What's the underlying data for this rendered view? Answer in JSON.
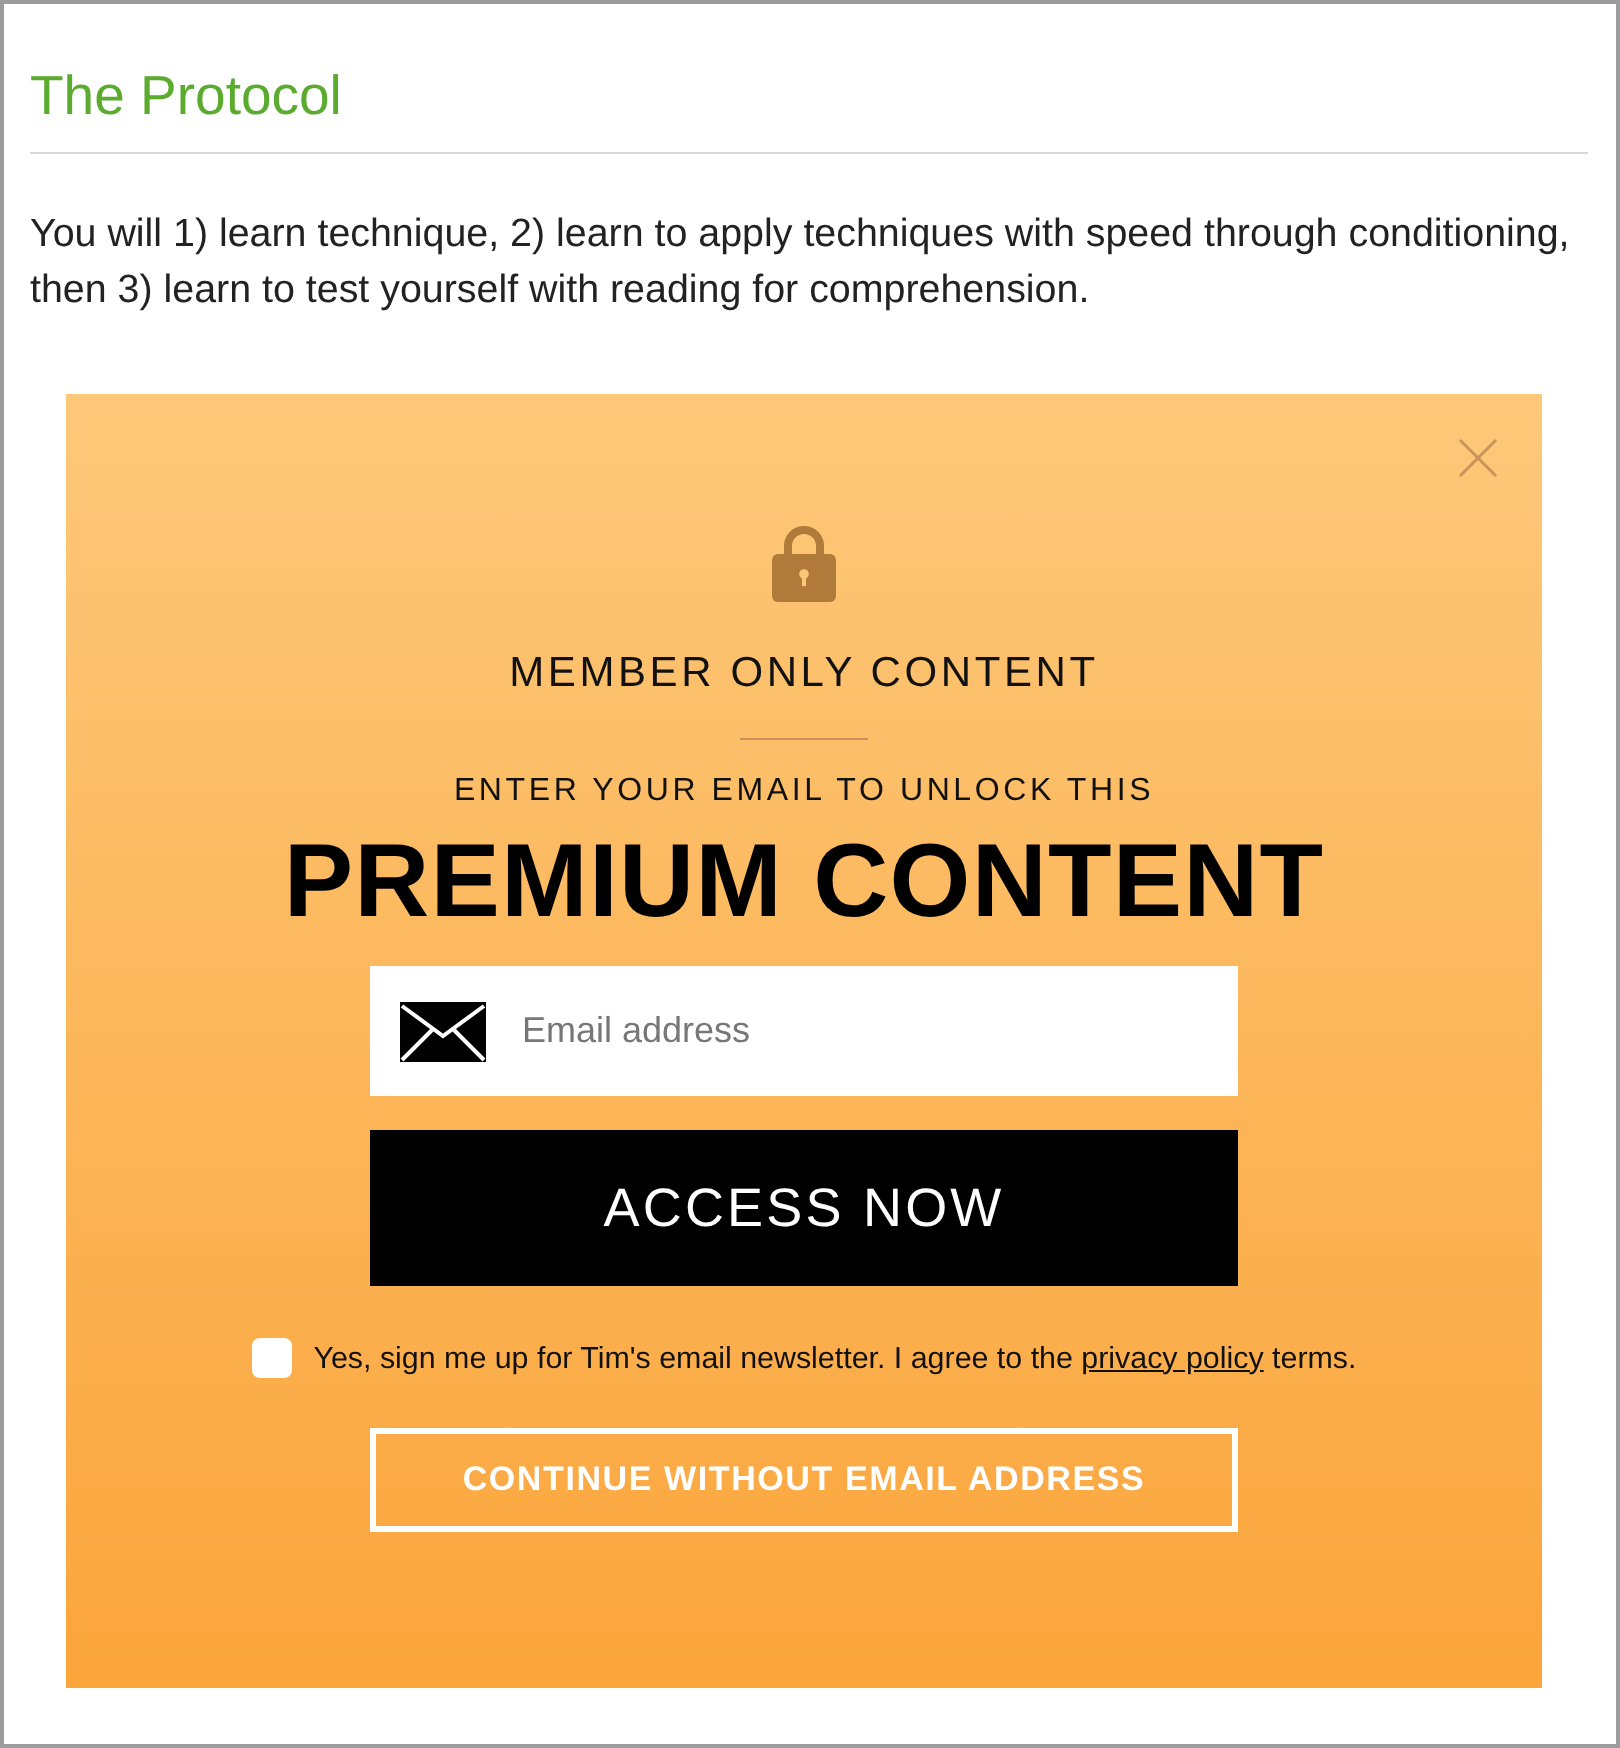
{
  "article": {
    "heading": "The Protocol",
    "paragraph": "You will 1) learn technique, 2) learn to apply techniques with speed through conditioning, then 3) learn to test yourself with reading for comprehension."
  },
  "popup": {
    "title": "MEMBER ONLY CONTENT",
    "subtitle": "ENTER YOUR EMAIL TO UNLOCK THIS",
    "headline": "PREMIUM CONTENT",
    "email_field": {
      "placeholder": "Email address"
    },
    "submit_button": "ACCESS NOW",
    "newsletter": {
      "checked": false,
      "text_before": "Yes, sign me up for Tim's email newsletter. I agree to the",
      "link": "privacy policy",
      "text_after": "terms."
    },
    "skip_button": "CONTINUE WITHOUT EMAIL ADDRESS"
  }
}
